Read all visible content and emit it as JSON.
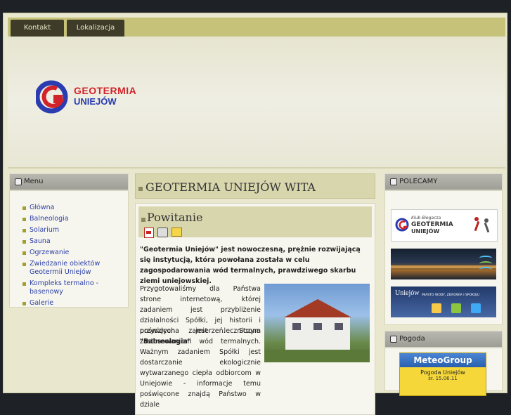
{
  "nav": {
    "tabs": [
      "Kontakt",
      "Lokalizacja"
    ]
  },
  "logo": {
    "line1": "GEOTERMIA",
    "line2": "UNIEJÓW"
  },
  "menu": {
    "title": "Menu",
    "items": [
      "Główna",
      "Balneologia",
      "Solarium",
      "Sauna",
      "Ogrzewanie",
      "Zwiedzanie obiektów Geotermii Uniejów",
      "Kompleks termalno - basenowy",
      "Galerie"
    ]
  },
  "main": {
    "headline": "GEOTERMIA UNIEJÓW WITA",
    "article_title": "Powitanie",
    "intro_bold": "\"Geotermia Uniejów\" jest nowoczesną, prężnie rozwijającą się instytucją, która powołana została w celu zagospodarowania wód termalnych, prawdziwego skarbu ziemi uniejowskiej.",
    "para1": "Przygotowaliśmy dla Państwa strone internetową, której zadaniem jest przybliżenie działalności Spółki, jej historii i przyszłych zamierzeń. Strona",
    "para1_bold": "\"Balneologia\"",
    "para2": "poświęcona jest leczniczym zastosowaniom wód termalnych. Ważnym zadaniem Spółki jest dostarczanie ekologicznie wytwarzanego ciepła odbiorcom w Uniejowie - informacje temu poświęcone znajdą Państwo w dziale",
    "icons": [
      "pdf-icon",
      "print-icon",
      "email-icon"
    ]
  },
  "polecamy": {
    "title": "POLECAMY",
    "banners": [
      {
        "small": "Klub Biegacza",
        "big": "GEOTERMIA",
        "big2": "UNIEJÓW"
      },
      {
        "label": ""
      },
      {
        "brand": "Uniejów",
        "tagline": "MIASTO WODY, ZDROWIA I SPOKOJU"
      }
    ]
  },
  "pogoda": {
    "title": "Pogoda",
    "brand": "MeteoGroup",
    "location": "Pogoda Uniejów",
    "date": "śr. 15.06.11"
  },
  "colors": {
    "accent": "#c6c279",
    "link": "#2b3fa8",
    "header_bar": "#9e9e96"
  }
}
